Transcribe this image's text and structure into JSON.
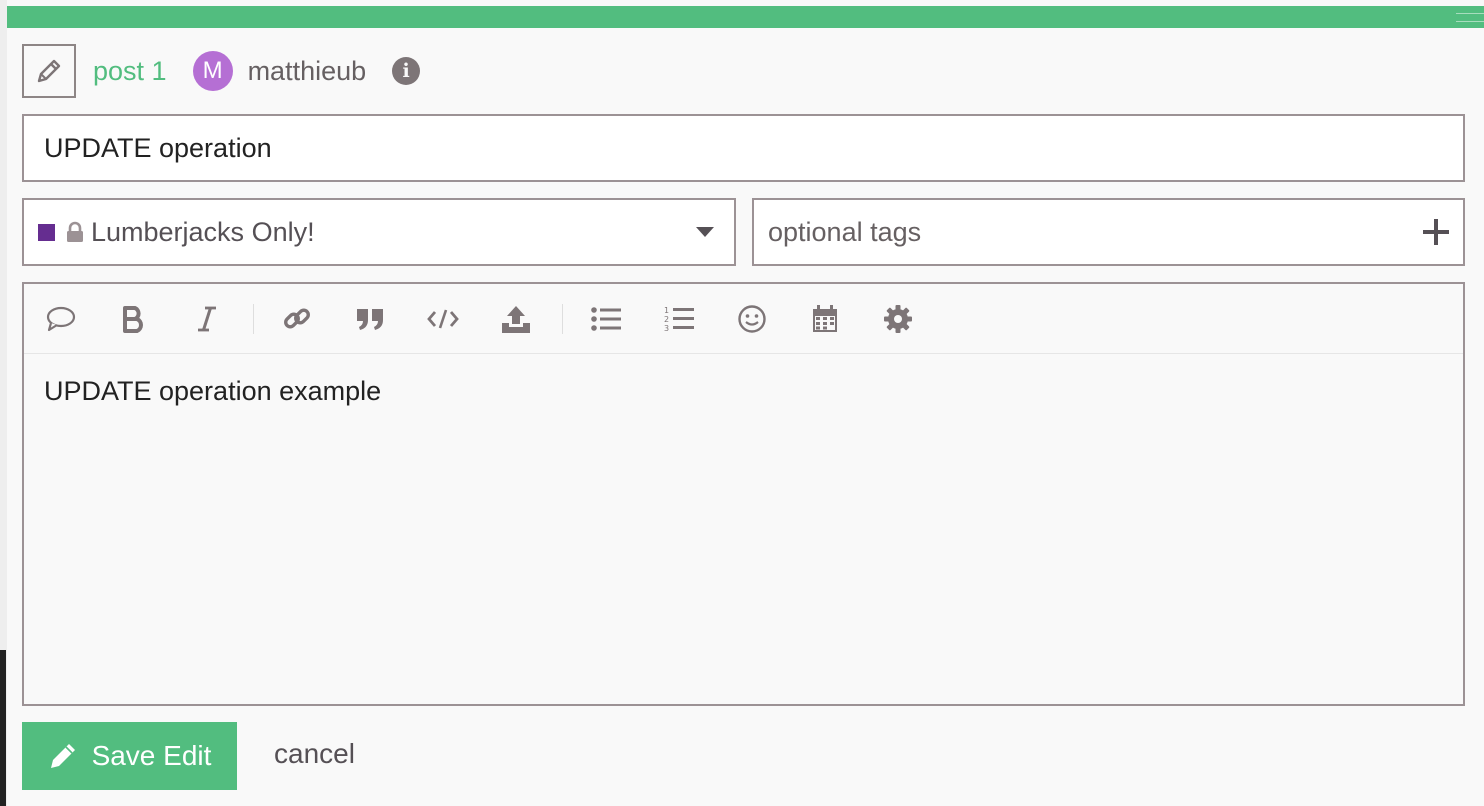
{
  "reply_header": {
    "post_link": "post 1",
    "avatar_letter": "M",
    "username": "matthieub"
  },
  "title_input": {
    "value": "UPDATE operation"
  },
  "category": {
    "name": "Lumberjacks Only!",
    "swatch_color": "#652d90",
    "restricted": true
  },
  "tags": {
    "placeholder": "optional tags"
  },
  "toolbar": {
    "buttons": [
      "speech-bubble-icon",
      "bold-icon",
      "italic-icon",
      "link-icon",
      "quote-icon",
      "code-icon",
      "upload-icon",
      "bullet-list-icon",
      "numbered-list-icon",
      "emoji-icon",
      "calendar-icon",
      "gear-icon"
    ]
  },
  "editor": {
    "body": "UPDATE operation example"
  },
  "actions": {
    "save_label": "Save Edit",
    "cancel_label": "cancel"
  },
  "colors": {
    "accent": "#52bd7f",
    "avatar": "#b56fd4",
    "border": "#9c9295",
    "icon": "#7d7577"
  }
}
